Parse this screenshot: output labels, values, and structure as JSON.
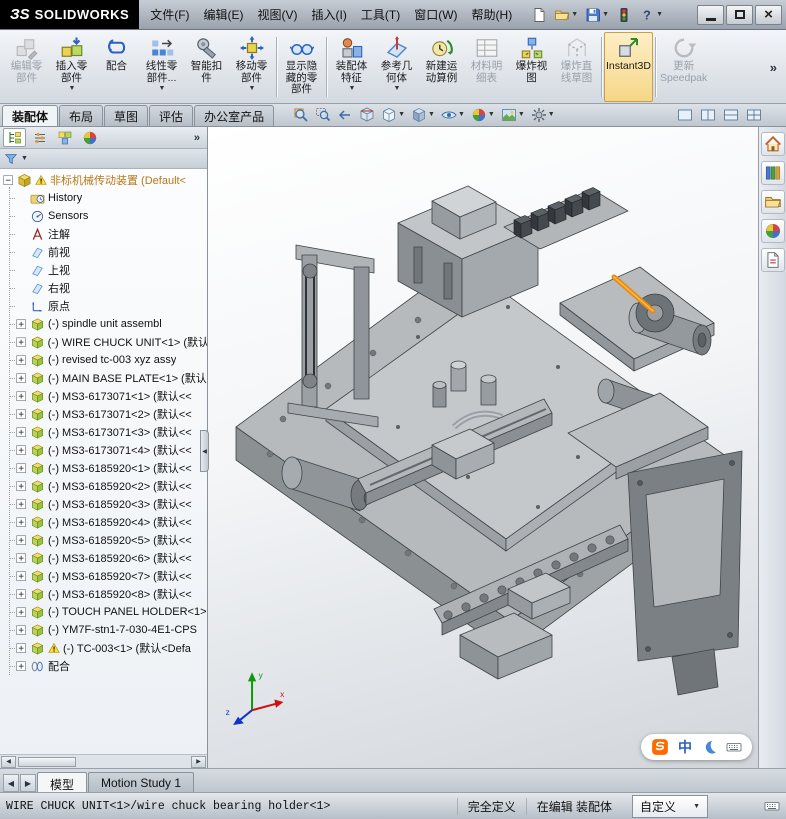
{
  "titlebar": {
    "logo_mark": "ЗS",
    "logo_brand": "SOLIDWORKS",
    "menus": [
      {
        "id": "file",
        "label": "文件(F)"
      },
      {
        "id": "edit",
        "label": "编辑(E)"
      },
      {
        "id": "view",
        "label": "视图(V)"
      },
      {
        "id": "insert",
        "label": "插入(I)"
      },
      {
        "id": "tools",
        "label": "工具(T)"
      },
      {
        "id": "window",
        "label": "窗口(W)"
      },
      {
        "id": "help",
        "label": "帮助(H)"
      }
    ],
    "quick_buttons": [
      {
        "id": "new-document"
      },
      {
        "id": "open",
        "arrow": true
      },
      {
        "id": "save",
        "arrow": true
      },
      {
        "id": "rebuild"
      },
      {
        "id": "help",
        "arrow": true
      }
    ],
    "window_buttons": [
      {
        "id": "minimize"
      },
      {
        "id": "maximize"
      },
      {
        "id": "close"
      }
    ]
  },
  "ribbon": {
    "overflow_label": "»",
    "buttons": [
      {
        "id": "edit-component",
        "label": "编辑零\n部件",
        "disabled": true
      },
      {
        "id": "insert-component",
        "label": "插入零\n部件",
        "arrow": true
      },
      {
        "id": "mate",
        "label": "配合"
      },
      {
        "id": "linear-pattern",
        "label": "线性零\n部件...",
        "arrow": true
      },
      {
        "id": "smart-fasteners",
        "label": "智能扣\n件"
      },
      {
        "id": "move-component",
        "label": "移动零\n部件",
        "arrow": true,
        "sep_after": true
      },
      {
        "id": "show-hidden",
        "label": "显示隐\n藏的零\n部件",
        "sep_after": true
      },
      {
        "id": "assembly-features",
        "label": "装配体\n特征",
        "arrow": true
      },
      {
        "id": "reference-geometry",
        "label": "参考几\n何体",
        "arrow": true
      },
      {
        "id": "motion-study",
        "label": "新建运\n动算例"
      },
      {
        "id": "bom",
        "label": "材料明\n细表",
        "disabled": true
      },
      {
        "id": "exploded-view",
        "label": "爆炸视\n图"
      },
      {
        "id": "explode-line-sketch",
        "label": "爆炸直\n线草图",
        "disabled": true,
        "sep_after": true
      },
      {
        "id": "instant3d",
        "label": "Instant3D",
        "pressed": true,
        "sep_after": true
      },
      {
        "id": "update-speedpak",
        "label": "更新\nSpeedpak",
        "disabled": true
      }
    ]
  },
  "command_tabs": {
    "items": [
      {
        "id": "assembly",
        "label": "装配体",
        "active": true
      },
      {
        "id": "layout",
        "label": "布局"
      },
      {
        "id": "sketch",
        "label": "草图"
      },
      {
        "id": "evaluate",
        "label": "评估"
      },
      {
        "id": "office-products",
        "label": "办公室产品"
      }
    ]
  },
  "headsup": [
    {
      "id": "zoom-fit"
    },
    {
      "id": "zoom-area"
    },
    {
      "id": "previous-view"
    },
    {
      "id": "section-view"
    },
    {
      "id": "view-orientation",
      "arrow": true
    },
    {
      "id": "display-style",
      "arrow": true
    },
    {
      "id": "hide-show",
      "arrow": true
    },
    {
      "id": "edit-appearance",
      "arrow": true
    },
    {
      "id": "apply-scene",
      "arrow": true
    },
    {
      "id": "view-settings",
      "arrow": true
    }
  ],
  "viewport_buttons": [
    {
      "id": "pane-single"
    },
    {
      "id": "pane-split-h"
    },
    {
      "id": "pane-split-v"
    },
    {
      "id": "pane-quad"
    }
  ],
  "feature_panel": {
    "overflow": "»",
    "tabs": [
      {
        "id": "feature-manager",
        "active": true
      },
      {
        "id": "property-manager"
      },
      {
        "id": "configuration-manager"
      },
      {
        "id": "display-manager"
      }
    ]
  },
  "tree": {
    "items": [
      {
        "id": "root",
        "icon": "assembly-root",
        "expand": "minus",
        "warn": true,
        "root": true,
        "color": "#b97715",
        "label": "非标机械传动装置 (Default<"
      },
      {
        "id": "history",
        "icon": "history",
        "label": "History"
      },
      {
        "id": "sensors",
        "icon": "sensors",
        "label": "Sensors"
      },
      {
        "id": "annotations",
        "icon": "annotations",
        "label": "注解"
      },
      {
        "id": "front-plane",
        "icon": "plane",
        "label": "前视"
      },
      {
        "id": "top-plane",
        "icon": "plane",
        "label": "上视"
      },
      {
        "id": "right-plane",
        "icon": "plane",
        "label": "右视"
      },
      {
        "id": "origin",
        "icon": "origin",
        "label": "原点"
      },
      {
        "id": "spindle-unit-assembly",
        "icon": "component",
        "expand": "plus",
        "label": "(-) spindle unit assembl"
      },
      {
        "id": "wire-chuck-unit-1",
        "icon": "component",
        "expand": "plus",
        "label": "(-) WIRE CHUCK UNIT<1> (默认"
      },
      {
        "id": "revised-tc-003-xyz-assy",
        "icon": "component",
        "expand": "plus",
        "label": "(-) revised tc-003 xyz assy"
      },
      {
        "id": "main-base-plate-1",
        "icon": "component",
        "expand": "plus",
        "label": "(-) MAIN BASE PLATE<1> (默认"
      },
      {
        "id": "ms3-6173071-1",
        "icon": "component",
        "expand": "plus",
        "label": "(-) MS3-6173071<1> (默认<<"
      },
      {
        "id": "ms3-6173071-2",
        "icon": "component",
        "expand": "plus",
        "label": "(-) MS3-6173071<2> (默认<<"
      },
      {
        "id": "ms3-6173071-3",
        "icon": "component",
        "expand": "plus",
        "label": "(-) MS3-6173071<3> (默认<<"
      },
      {
        "id": "ms3-6173071-4",
        "icon": "component",
        "expand": "plus",
        "label": "(-) MS3-6173071<4> (默认<<"
      },
      {
        "id": "ms3-6185920-1",
        "icon": "component",
        "expand": "plus",
        "label": "(-) MS3-6185920<1> (默认<<"
      },
      {
        "id": "ms3-6185920-2",
        "icon": "component",
        "expand": "plus",
        "label": "(-) MS3-6185920<2> (默认<<"
      },
      {
        "id": "ms3-6185920-3",
        "icon": "component",
        "expand": "plus",
        "label": "(-) MS3-6185920<3> (默认<<"
      },
      {
        "id": "ms3-6185920-4",
        "icon": "component",
        "expand": "plus",
        "label": "(-) MS3-6185920<4> (默认<<"
      },
      {
        "id": "ms3-6185920-5",
        "icon": "component",
        "expand": "plus",
        "label": "(-) MS3-6185920<5> (默认<<"
      },
      {
        "id": "ms3-6185920-6",
        "icon": "component",
        "expand": "plus",
        "label": "(-) MS3-6185920<6> (默认<<"
      },
      {
        "id": "ms3-6185920-7",
        "icon": "component",
        "expand": "plus",
        "label": "(-) MS3-6185920<7> (默认<<"
      },
      {
        "id": "ms3-6185920-8",
        "icon": "component",
        "expand": "plus",
        "label": "(-) MS3-6185920<8> (默认<<"
      },
      {
        "id": "touch-panel-holder-1",
        "icon": "component",
        "expand": "plus",
        "label": "(-) TOUCH PANEL HOLDER<1>"
      },
      {
        "id": "ym7f-stn1",
        "icon": "component",
        "expand": "plus",
        "label": "(-) YM7F-stn1-7-030-4E1-CPS"
      },
      {
        "id": "tc-003-1",
        "icon": "component",
        "expand": "plus",
        "warn": true,
        "label": "(-) TC-003<1> (默认<Defa"
      },
      {
        "id": "mates",
        "icon": "mates",
        "expand": "plus",
        "label": "配合"
      }
    ]
  },
  "taskpane": [
    {
      "id": "solidworks-resources"
    },
    {
      "id": "design-library"
    },
    {
      "id": "file-explorer"
    },
    {
      "id": "appearances"
    },
    {
      "id": "custom-properties"
    }
  ],
  "model_view": {
    "triad": {
      "x": "x",
      "y": "y",
      "z": "z"
    }
  },
  "ime": {
    "chinese_label": "中"
  },
  "sheet_tabs": {
    "nav": [
      "◀",
      "▶"
    ],
    "tabs": [
      {
        "id": "model",
        "label": "模型",
        "active": true
      },
      {
        "id": "motion-study-1",
        "label": "Motion Study 1"
      }
    ]
  },
  "statusbar": {
    "message": "WIRE CHUCK UNIT<1>/wire chuck bearing holder<1>",
    "state": "完全定义",
    "editing": "在编辑 装配体",
    "custom": "自定义"
  }
}
